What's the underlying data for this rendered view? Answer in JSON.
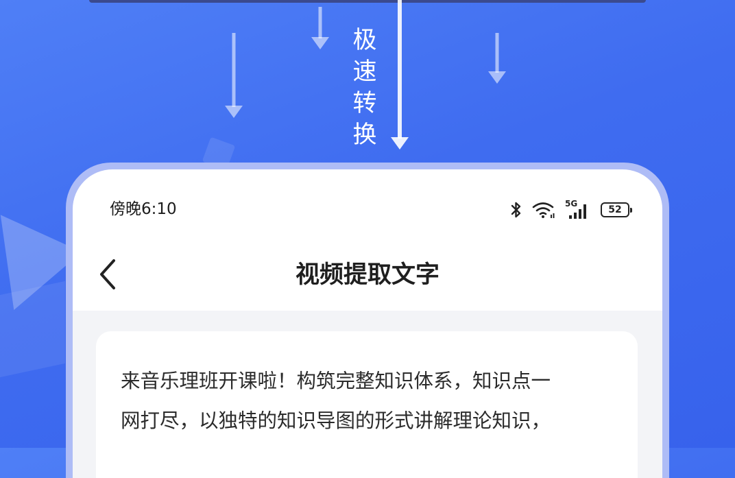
{
  "tagline": [
    "极",
    "速",
    "转",
    "换"
  ],
  "status_bar": {
    "time": "傍晚6:10",
    "network_label": "5G",
    "battery_level": "52",
    "icons": [
      "bluetooth-icon",
      "wifi-icon",
      "signal-icon",
      "battery-icon"
    ]
  },
  "nav": {
    "title": "视频提取文字",
    "back_icon": "chevron-left-icon"
  },
  "content": {
    "lines": [
      "来音乐理班开课啦！构筑完整知识体系，知识点一",
      "网打尽，以独特的知识导图的形式讲解理论知识，"
    ]
  },
  "colors": {
    "background": "#3f6cf0",
    "frame": "#aebcf6",
    "content_bg": "#f3f4f7"
  }
}
